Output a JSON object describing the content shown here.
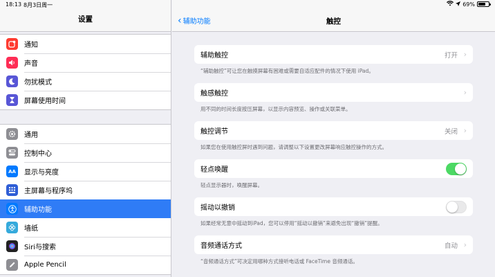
{
  "status": {
    "time": "18:13",
    "date": "8月3日周一",
    "battery": "69%",
    "battery_level": 0.69
  },
  "sidebar": {
    "title": "设置",
    "group1": [
      {
        "label": "通知",
        "icon": "notifications-icon",
        "color": "#fe3b30"
      },
      {
        "label": "声音",
        "icon": "sounds-icon",
        "color": "#fe2d55"
      },
      {
        "label": "勿扰模式",
        "icon": "moon-icon",
        "color": "#5856d6"
      },
      {
        "label": "屏幕使用时间",
        "icon": "hourglass-icon",
        "color": "#5856d6"
      }
    ],
    "group2": [
      {
        "label": "通用",
        "icon": "gear-icon",
        "color": "#8e8e93"
      },
      {
        "label": "控制中心",
        "icon": "control-center-icon",
        "color": "#8e8e93"
      },
      {
        "label": "显示与亮度",
        "icon": "display-icon",
        "color": "#007aff"
      },
      {
        "label": "主屏幕与程序坞",
        "icon": "home-screen-icon",
        "color": "#2f5ed6"
      },
      {
        "label": "辅助功能",
        "icon": "accessibility-icon",
        "color": "#007aff"
      },
      {
        "label": "墙纸",
        "icon": "wallpaper-icon",
        "color": "#35aadc"
      },
      {
        "label": "Siri与搜索",
        "icon": "siri-icon",
        "color": "#222222"
      },
      {
        "label": "Apple Pencil",
        "icon": "pencil-icon",
        "color": "#8e8e93"
      }
    ]
  },
  "detail": {
    "back_label": "辅助功能",
    "title": "触控",
    "rows": [
      {
        "label": "辅助触控",
        "value": "打开",
        "desc": "“辅助触控”可让您在触摸屏幕有困难或需要自适应配件的情况下使用 iPad。"
      },
      {
        "label": "触感触控",
        "value": "",
        "desc": "用不同的时间长度按压屏幕，以显示内容预览、操作或关联菜单。"
      },
      {
        "label": "触控调节",
        "value": "关闭",
        "desc": "如果您在使用触控屏时遇到问题，请调整以下设置更改屏幕响应触控操作的方式。"
      },
      {
        "label": "轻点唤醒",
        "toggle": true,
        "desc": "轻点显示器时，唤醒屏幕。"
      },
      {
        "label": "摇动以撤销",
        "toggle": false,
        "desc": "如果经常无意中摇动到iPad，您可以停用“摇动以撤销”来避免出现“撤销”提醒。"
      },
      {
        "label": "音频通话方式",
        "value": "自动",
        "desc": "“音频通话方式”可决定用哪种方式接听电话或 FaceTime 音频通话。"
      }
    ]
  }
}
